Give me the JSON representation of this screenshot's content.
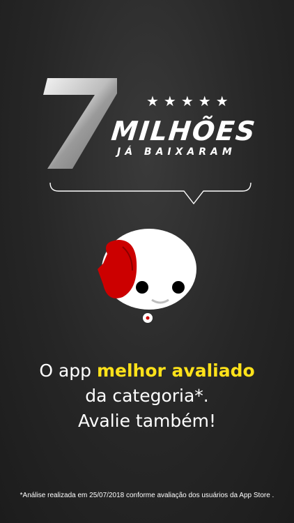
{
  "badge": {
    "number": "7",
    "stars": "★★★★★",
    "title": "MILHÕES",
    "subtitle": "JÁ BAIXARAM"
  },
  "mascot": {
    "icon": "mascot-character-icon"
  },
  "headline": {
    "prefix": "O app ",
    "highlight": "melhor avaliado",
    "line2": "da categoria*.",
    "line3": "Avalie também!"
  },
  "footnote": "*Análise realizada em 25/07/2018 conforme avaliação dos usuários da App Store .",
  "colors": {
    "background": "#262626",
    "highlight": "#ffe21a",
    "mascot_red": "#cc0000",
    "text": "#ffffff"
  }
}
